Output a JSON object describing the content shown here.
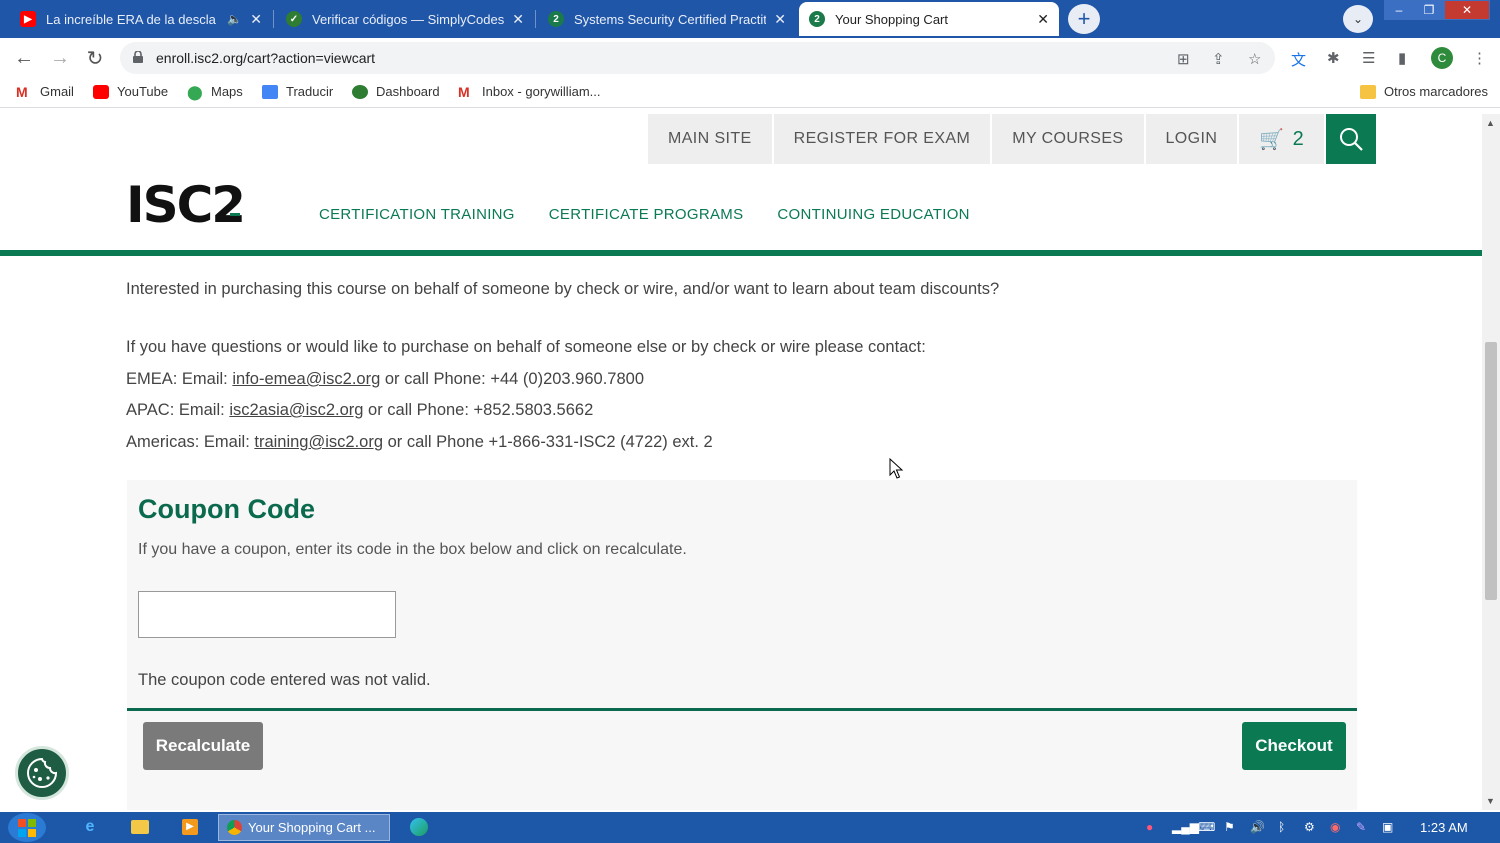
{
  "browser": {
    "tabs": [
      {
        "title": "La increíble ERA de la descla",
        "favicon": "youtube-icon",
        "color": "#ff0000"
      },
      {
        "title": "Verificar códigos — SimplyCodes",
        "favicon": "simplycodes-icon",
        "color": "#2e7d32"
      },
      {
        "title": "Systems Security Certified Practit",
        "favicon": "quizlet-2-icon",
        "color": "#1b7a4a"
      },
      {
        "title": "Your Shopping Cart",
        "favicon": "isc2-2-icon",
        "color": "#1b7a4a"
      }
    ],
    "url": "enroll.isc2.org/cart?action=viewcart",
    "profile_initial": "C",
    "bookmarks": [
      {
        "label": "Gmail"
      },
      {
        "label": "YouTube"
      },
      {
        "label": "Maps"
      },
      {
        "label": "Traducir"
      },
      {
        "label": "Dashboard"
      },
      {
        "label": "Inbox - gorywilliam..."
      }
    ],
    "other_bookmarks": "Otros marcadores"
  },
  "site": {
    "top_nav": [
      "MAIN SITE",
      "REGISTER FOR EXAM",
      "MY COURSES",
      "LOGIN"
    ],
    "cart_count": "2",
    "logo": "ISC2",
    "main_nav": [
      "CERTIFICATION TRAINING",
      "CERTIFICATE PROGRAMS",
      "CONTINUING EDUCATION"
    ],
    "accent_color": "#0b7a53"
  },
  "content": {
    "intro": "Interested in purchasing this course on behalf of someone by check or wire, and/or want to learn about team discounts?",
    "contact_intro": "If you have questions or would like to purchase on behalf of someone else or by check or wire please contact:",
    "emea": {
      "prefix": "EMEA: Email: ",
      "email": "info-emea@isc2.org",
      "suffix": " or call Phone: +44 (0)203.960.7800"
    },
    "apac": {
      "prefix": "APAC: Email: ",
      "email": "isc2asia@isc2.org",
      "suffix": " or call Phone: +852.5803.5662"
    },
    "americas": {
      "prefix": "Americas: Email: ",
      "email": "training@isc2.org",
      "suffix": " or call Phone +1-866-331-ISC2 (4722) ext. 2"
    }
  },
  "coupon": {
    "title": "Coupon Code",
    "description": "If you have a coupon, enter its code in the box below and click on recalculate.",
    "input_value": "",
    "error": "The coupon code entered was not valid.",
    "recalculate_label": "Recalculate",
    "checkout_label": "Checkout"
  },
  "taskbar": {
    "active_task": "Your Shopping Cart ...",
    "clock": "1:23 AM"
  }
}
